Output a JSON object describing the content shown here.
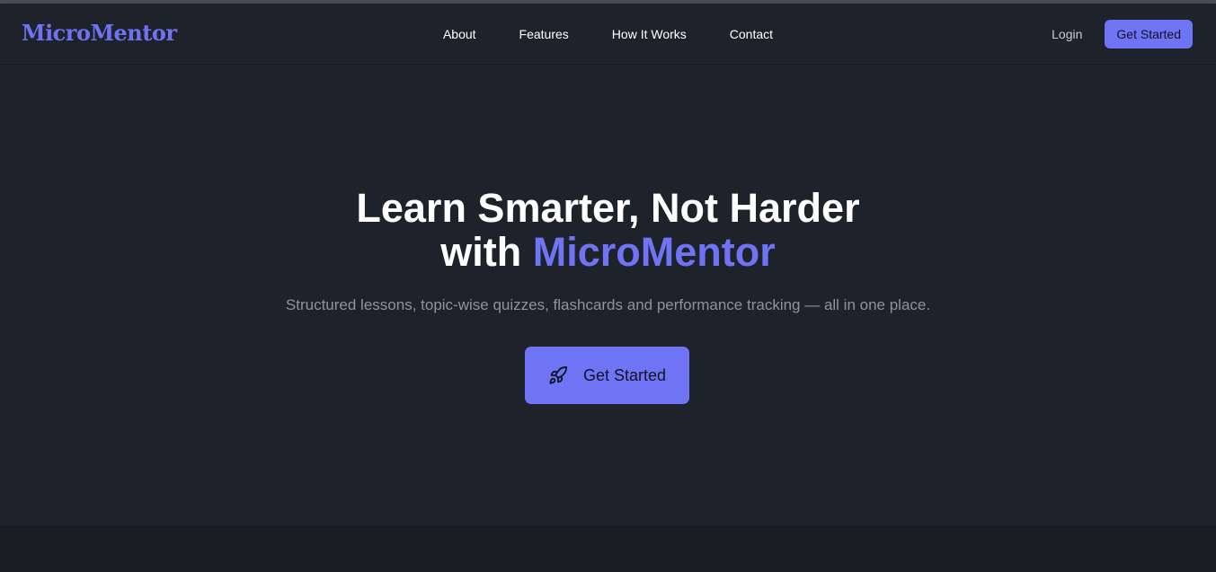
{
  "brand": {
    "logo_text": "MicroMentor",
    "accent_color": "#6f74f5"
  },
  "nav": {
    "links": [
      {
        "label": "About"
      },
      {
        "label": "Features"
      },
      {
        "label": "How It Works"
      },
      {
        "label": "Contact"
      }
    ],
    "login_label": "Login",
    "get_started_label": "Get Started"
  },
  "hero": {
    "title_line1": "Learn Smarter, Not Harder",
    "title_line2_prefix": "with",
    "title_line2_brand": "MicroMentor",
    "subtitle": "Structured lessons, topic-wise quizzes, flashcards and performance tracking — all in one place.",
    "cta_label": "Get Started",
    "cta_icon": "rocket-icon"
  }
}
